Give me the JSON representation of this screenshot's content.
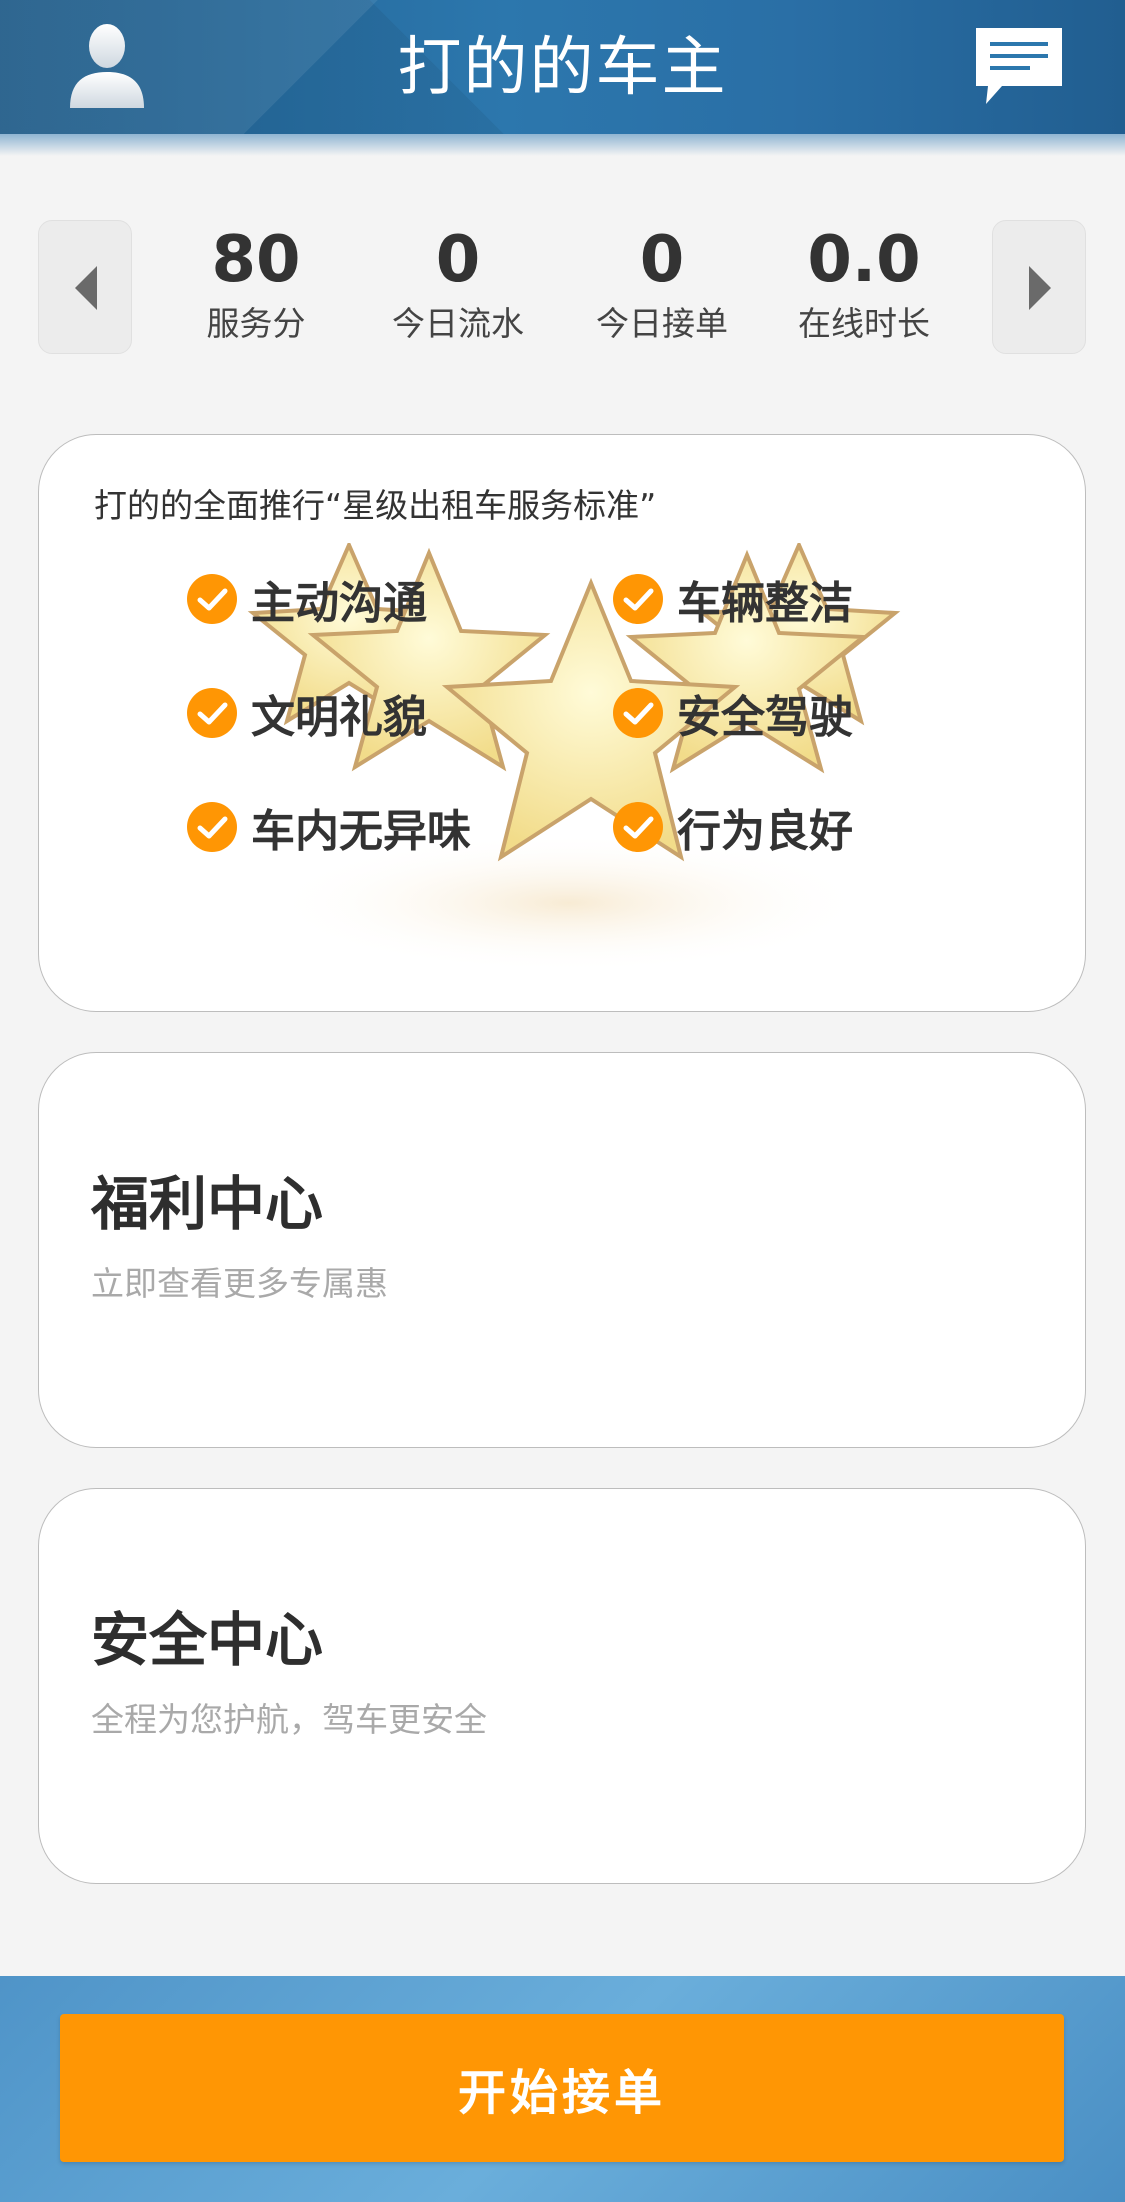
{
  "header": {
    "title": "打的的车主",
    "avatar_icon": "user-silhouette-icon",
    "message_icon": "message-bubble-icon"
  },
  "stats": [
    {
      "value": "80",
      "label": "服务分"
    },
    {
      "value": "0",
      "label": "今日流水"
    },
    {
      "value": "0",
      "label": "今日接单"
    },
    {
      "value": "0.0",
      "label": "在线时长"
    }
  ],
  "promo": {
    "title": "打的的全面推行“星级出租车服务标准”",
    "features": [
      {
        "label": "主动沟通"
      },
      {
        "label": "车辆整洁"
      },
      {
        "label": "文明礼貌"
      },
      {
        "label": "安全驾驶"
      },
      {
        "label": "车内无异味"
      },
      {
        "label": "行为良好"
      }
    ]
  },
  "welfare": {
    "title": "福利中心",
    "subtitle": "立即查看更多专属惠"
  },
  "safety": {
    "title": "安全中心",
    "subtitle": "全程为您护航，驾车更安全"
  },
  "bottom": {
    "start_button": "开始接单"
  },
  "colors": {
    "header": "#2a6fa6",
    "accent": "#ff9604",
    "bottom_bar": "#5aa1d2"
  }
}
